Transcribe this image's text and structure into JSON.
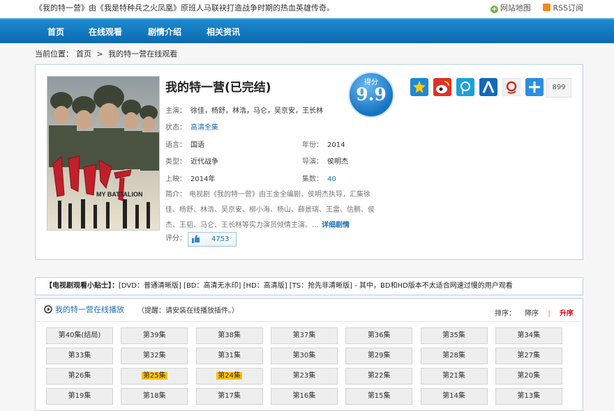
{
  "topbar": {
    "intro": "《我的特一营》由《我是特种兵之火凤凰》原班人马联袂打造战争时期的热血英雄传奇。",
    "sitemap": "网站地图",
    "rss": "RSS订阅",
    "sitemap_icon": "plus-icon",
    "rss_icon": "rss-icon"
  },
  "nav": [
    "首页",
    "在线观看",
    "剧情介绍",
    "相关资讯"
  ],
  "breadcrumb": {
    "prefix": "当前位置：",
    "home": "首页",
    "sep": ">",
    "current": "我的特一营在线观看"
  },
  "show": {
    "title": "我的特一营(已完结)",
    "cast_label": "主演：",
    "cast": "徐佳，杨舒，林浩，马仑，吴京安，王长林",
    "status_label": "状态：",
    "status": "高清全集",
    "language_label": "语言：",
    "language": "国语",
    "year_label": "年份：",
    "year": "2014",
    "genre_label": "类型：",
    "genre": "近代战争",
    "director_label": "导演：",
    "director": "侯明杰",
    "release_label": "上映：",
    "release": "2014年",
    "episodes_label": "集数：",
    "episodes": "40",
    "intro_label": "简介：",
    "intro": "电视剧《我的特一营》由王金全编剧，侯明杰执导，汇集徐佳、杨舒、林浩、吴京安、柳小海、杨山、薛景瑞、王雷、信鹏、侯杰、王韬、马仑、王长林等实力演员倾情主演。…",
    "more": "详细剧情",
    "rating_label": "评分：",
    "rating_count": "4753",
    "score_label": "得分",
    "score": "9.9",
    "share_count": "899",
    "poster_title": "我的特一营",
    "poster_subtitle": "MY BATTALION"
  },
  "share_icons": [
    "star-share-icon",
    "weibo-share-icon",
    "tencent-weibo-share-icon",
    "renren-share-icon",
    "sohu-share-icon",
    "more-share-icon"
  ],
  "tip": {
    "head": "【电视剧观看小贴士】：",
    "text": "[DVD：普通清晰版] [BD：高清无水印] [HD：高清版] [TS：抢先非清晰版] - 其中，BD和HD版本不太适合网速过慢的用户观看"
  },
  "play": {
    "title": "我的特一营在线播放",
    "note": "（提醒：请安装在线播放插件。）",
    "sort_label": "排序：",
    "desc": "降序",
    "sep": "|",
    "asc": "升序",
    "episodes": [
      [
        "第40集(结局)",
        "第39集",
        "第38集",
        "第37集",
        "第36集",
        "第35集",
        "第34集"
      ],
      [
        "第33集",
        "第32集",
        "第31集",
        "第30集",
        "第29集",
        "第28集",
        "第27集"
      ],
      [
        "第26集",
        "第25集",
        "第24集",
        "第23集",
        "第22集",
        "第21集",
        "第20集"
      ],
      [
        "第19集",
        "第18集",
        "第17集",
        "第16集",
        "第15集",
        "第14集",
        "第13集"
      ]
    ],
    "highlighted": [
      "第25集",
      "第24集"
    ]
  },
  "colors": {
    "nav": "#0b6bb0",
    "link": "#1c6fb6",
    "highlight": "#ffc20e",
    "asc": "#e01111"
  }
}
